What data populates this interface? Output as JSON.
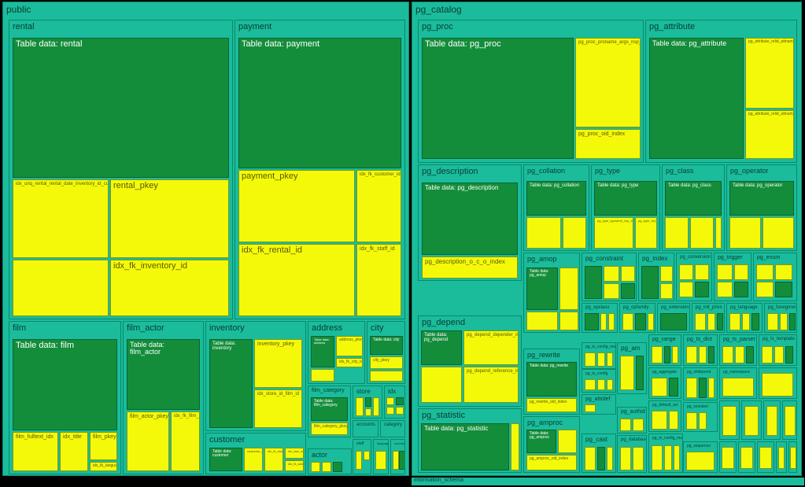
{
  "chart_data": {
    "type": "treemap",
    "title": "",
    "schemas": [
      {
        "name": "public",
        "approx_share": 0.49,
        "tables": [
          {
            "name": "rental",
            "data_label": "Table data: rental",
            "indexes": [
              "idx_unq_rental_rental_date_inventory_id_customer_id",
              "rental_pkey",
              "idx_fk_inventory_id"
            ]
          },
          {
            "name": "payment",
            "data_label": "Table data: payment",
            "indexes": [
              "payment_pkey",
              "idx_fk_customer_id",
              "idx_fk_rental_id",
              "idx_fk_staff_id"
            ]
          },
          {
            "name": "film",
            "data_label": "Table data: film",
            "indexes": [
              "film_fulltext_idx",
              "idx_title",
              "film_pkey",
              "idx_fk_language_id"
            ]
          },
          {
            "name": "film_actor",
            "data_label": "Table data: film_actor",
            "indexes": [
              "film_actor_pkey",
              "idx_fk_film_id"
            ]
          },
          {
            "name": "inventory",
            "data_label": "Table data: inventory",
            "indexes": [
              "inventory_pkey",
              "idx_store_id_film_id"
            ]
          },
          {
            "name": "customer",
            "data_label": "Table data: customer",
            "indexes": [
              "customer_pkey",
              "idx_last_name",
              "idx_fk_address_id",
              "idx_fk_store_id"
            ]
          },
          {
            "name": "address",
            "data_label": "Table data: address",
            "indexes": [
              "address_pkey",
              "idx_fk_city_id"
            ]
          },
          {
            "name": "city",
            "data_label": "Table data: city",
            "indexes": [
              "city_pkey"
            ]
          },
          {
            "name": "film_category",
            "data_label": "Table data: film_category",
            "indexes": [
              "film_category_pkey"
            ]
          },
          {
            "name": "store",
            "data_label": "",
            "indexes": []
          },
          {
            "name": "idx",
            "data_label": "",
            "indexes": []
          },
          {
            "name": "accounts",
            "data_label": "",
            "indexes": []
          },
          {
            "name": "category",
            "data_label": "",
            "indexes": []
          },
          {
            "name": "actor",
            "data_label": "",
            "indexes": []
          },
          {
            "name": "staff",
            "data_label": "",
            "indexes": []
          },
          {
            "name": "language",
            "data_label": "",
            "indexes": []
          },
          {
            "name": "country",
            "data_label": "",
            "indexes": []
          }
        ]
      },
      {
        "name": "pg_catalog",
        "approx_share": 0.49,
        "tables": [
          {
            "name": "pg_proc",
            "data_label": "Table data: pg_proc",
            "indexes": [
              "pg_proc_proname_args_nsp_index",
              "pg_proc_oid_index"
            ]
          },
          {
            "name": "pg_attribute",
            "data_label": "Table data: pg_attribute",
            "indexes": [
              "pg_attribute_relid_attnam_index",
              "pg_attribute_relid_attnum_index"
            ]
          },
          {
            "name": "pg_description",
            "data_label": "Table data: pg_description",
            "indexes": [
              "pg_description_o_c_o_index"
            ]
          },
          {
            "name": "pg_collation",
            "data_label": "Table data: pg_collation",
            "indexes": []
          },
          {
            "name": "pg_type",
            "data_label": "Table data: pg_type",
            "indexes": [
              "pg_type_typname_nsp_index",
              "pg_type_oid_index"
            ]
          },
          {
            "name": "pg_class",
            "data_label": "Table data: pg_class",
            "indexes": []
          },
          {
            "name": "pg_operator",
            "data_label": "Table data: pg_operator",
            "indexes": []
          },
          {
            "name": "pg_amop",
            "data_label": "Table data: pg_amop",
            "indexes": []
          },
          {
            "name": "pg_constraint",
            "data_label": "",
            "indexes": []
          },
          {
            "name": "pg_index",
            "data_label": "",
            "indexes": []
          },
          {
            "name": "pg_conversion",
            "data_label": "",
            "indexes": []
          },
          {
            "name": "pg_trigger",
            "data_label": "",
            "indexes": []
          },
          {
            "name": "pg_enum",
            "data_label": "",
            "indexes": []
          },
          {
            "name": "pg_opclass",
            "data_label": "",
            "indexes": []
          },
          {
            "name": "pg_opfamily",
            "data_label": "",
            "indexes": []
          },
          {
            "name": "pg_extension",
            "data_label": "",
            "indexes": []
          },
          {
            "name": "pg_init_privs",
            "data_label": "",
            "indexes": []
          },
          {
            "name": "pg_language",
            "data_label": "",
            "indexes": []
          },
          {
            "name": "pg_foreignrel",
            "data_label": "",
            "indexes": []
          },
          {
            "name": "pg_depend",
            "data_label": "Table data: pg_depend",
            "indexes": [
              "pg_depend_depender_index",
              "pg_depend_reference_index"
            ]
          },
          {
            "name": "pg_rewrite",
            "data_label": "Table data: pg_rewrite",
            "indexes": [
              "pg_rewrite_oid_index"
            ]
          },
          {
            "name": "pg_statistic",
            "data_label": "Table data: pg_statistic",
            "indexes": []
          },
          {
            "name": "pg_amproc",
            "data_label": "Table data: pg_amproc",
            "indexes": [
              "pg_amproc_oid_index"
            ]
          },
          {
            "name": "pg_range",
            "data_label": "",
            "indexes": []
          },
          {
            "name": "pg_ts_dict",
            "data_label": "",
            "indexes": []
          },
          {
            "name": "pg_ts_parser",
            "data_label": "",
            "indexes": []
          },
          {
            "name": "pg_ts_template",
            "data_label": "",
            "indexes": []
          },
          {
            "name": "pg_am",
            "data_label": "",
            "indexes": []
          },
          {
            "name": "pg_ts_config_map",
            "data_label": "",
            "indexes": []
          },
          {
            "name": "pg_ts_config",
            "data_label": "",
            "indexes": []
          },
          {
            "name": "pg_aggregate",
            "data_label": "",
            "indexes": []
          },
          {
            "name": "pg_shdepend",
            "data_label": "",
            "indexes": []
          },
          {
            "name": "pg_attrdef",
            "data_label": "",
            "indexes": []
          },
          {
            "name": "pg_authid",
            "data_label": "",
            "indexes": []
          },
          {
            "name": "pg_default_acl",
            "data_label": "",
            "indexes": []
          },
          {
            "name": "pg_seclabel",
            "data_label": "",
            "indexes": []
          },
          {
            "name": "pg_cast",
            "data_label": "",
            "indexes": []
          },
          {
            "name": "pg_database",
            "data_label": "",
            "indexes": []
          },
          {
            "name": "pg_ts_config_map2",
            "data_label": "",
            "indexes": []
          },
          {
            "name": "pg_sequence",
            "data_label": "",
            "indexes": []
          },
          {
            "name": "pg_namespace",
            "data_label": "",
            "indexes": []
          }
        ]
      },
      {
        "name": "information_schema",
        "approx_share": 0.02,
        "tables": []
      }
    ]
  },
  "labels": {
    "information_schema": "information_schema"
  }
}
